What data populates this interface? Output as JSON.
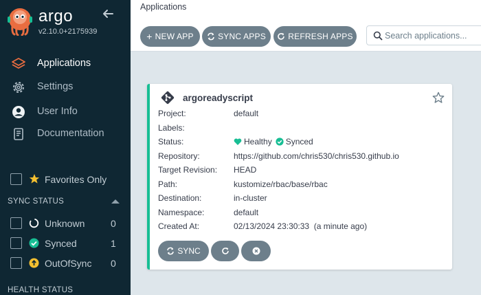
{
  "brand": {
    "name": "argo",
    "version": "v2.10.0+2175939"
  },
  "nav": [
    {
      "label": "Applications",
      "icon": "stack-icon",
      "active": true
    },
    {
      "label": "Settings",
      "icon": "gear-icon"
    },
    {
      "label": "User Info",
      "icon": "user-icon"
    },
    {
      "label": "Documentation",
      "icon": "doc-icon"
    }
  ],
  "favorites": {
    "label": "Favorites Only"
  },
  "sync_status": {
    "title": "SYNC STATUS",
    "items": [
      {
        "label": "Unknown",
        "count": "0"
      },
      {
        "label": "Synced",
        "count": "1"
      },
      {
        "label": "OutOfSync",
        "count": "0"
      }
    ]
  },
  "health_status": {
    "title": "HEALTH STATUS"
  },
  "header": {
    "title": "Applications"
  },
  "toolbar": {
    "new_app": "NEW APP",
    "sync_apps": "SYNC APPS",
    "refresh_apps": "REFRESH APPS",
    "search_placeholder": "Search applications..."
  },
  "app": {
    "name": "argoreadyscript",
    "fields": [
      {
        "key": "Project:",
        "value": "default"
      },
      {
        "key": "Labels:",
        "value": ""
      },
      {
        "key": "Status:",
        "health": "Healthy",
        "sync": "Synced"
      },
      {
        "key": "Repository:",
        "value": "https://github.com/chris530/chris530.github.io"
      },
      {
        "key": "Target Revision:",
        "value": "HEAD"
      },
      {
        "key": "Path:",
        "value": "kustomize/rbac/base/rbac"
      },
      {
        "key": "Destination:",
        "value": "in-cluster"
      },
      {
        "key": "Namespace:",
        "value": "default"
      },
      {
        "key": "Created At:",
        "value": "02/13/2024 23:30:33  (a minute ago)"
      }
    ],
    "sync_label": "SYNC"
  },
  "colors": {
    "sidebar": "#0f2733",
    "healthy": "#18be94",
    "button": "#6d7f8b",
    "out_of_sync": "#f4c030"
  }
}
